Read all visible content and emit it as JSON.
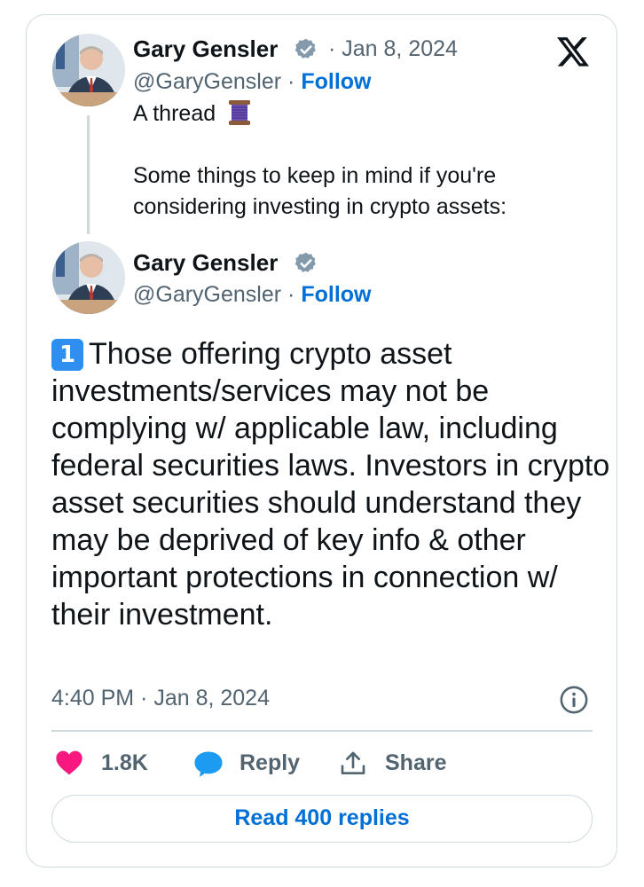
{
  "tweet1": {
    "author_name": "Gary Gensler",
    "date": "· Jan 8, 2024",
    "handle": "@GaryGensler",
    "separator": "·",
    "follow_label": "Follow",
    "text_line1": "A thread",
    "text_line2": "Some things to keep in mind if you're",
    "text_line3": "considering investing in crypto assets:"
  },
  "tweet2": {
    "author_name": "Gary Gensler",
    "handle": "@GaryGensler",
    "separator": "·",
    "follow_label": "Follow",
    "keycap_number": "1",
    "body": "Those offering crypto asset investments/services may not be complying w/ applicable law, including federal securities laws. Investors in crypto asset securities should understand they may be deprived of key info & other important protections in connection w/ their investment.",
    "timestamp": "4:40 PM · Jan 8, 2024"
  },
  "actions": {
    "like_count": "1.8K",
    "reply_label": "Reply",
    "share_label": "Share",
    "read_replies_label": "Read 400 replies"
  },
  "icons": {
    "verified": "verified-badge-icon",
    "brand": "x-logo-icon",
    "thread": "spool-of-thread-icon",
    "info": "info-icon",
    "like": "heart-icon",
    "reply": "speech-bubble-icon",
    "share": "share-upload-icon"
  },
  "colors": {
    "accent": "#006fd6",
    "muted": "#536471",
    "like": "#f91880",
    "reply": "#1d9bf0",
    "border": "#cfd9de"
  }
}
